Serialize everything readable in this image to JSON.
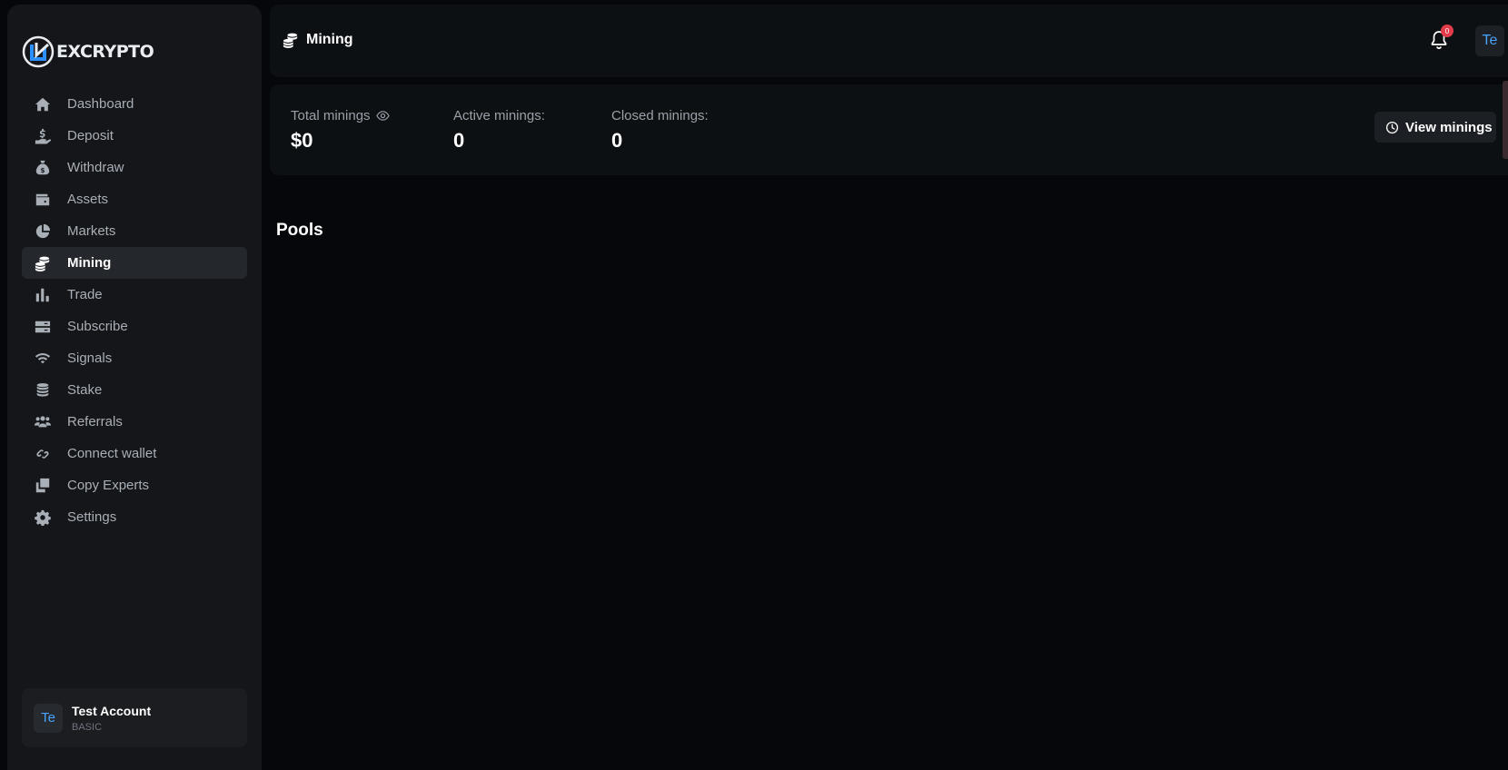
{
  "brand": {
    "name": "EXCRYPTO"
  },
  "sidebar": {
    "items": [
      {
        "label": "Dashboard",
        "icon": "home-icon",
        "active": false
      },
      {
        "label": "Deposit",
        "icon": "deposit-hand-icon",
        "active": false
      },
      {
        "label": "Withdraw",
        "icon": "money-bag-icon",
        "active": false
      },
      {
        "label": "Assets",
        "icon": "wallet-icon",
        "active": false
      },
      {
        "label": "Markets",
        "icon": "pie-chart-icon",
        "active": false
      },
      {
        "label": "Mining",
        "icon": "coins-icon",
        "active": true
      },
      {
        "label": "Trade",
        "icon": "bar-chart-icon",
        "active": false
      },
      {
        "label": "Subscribe",
        "icon": "server-icon",
        "active": false
      },
      {
        "label": "Signals",
        "icon": "wifi-icon",
        "active": false
      },
      {
        "label": "Stake",
        "icon": "coin-stack-icon",
        "active": false
      },
      {
        "label": "Referrals",
        "icon": "users-icon",
        "active": false
      },
      {
        "label": "Connect wallet",
        "icon": "link-icon",
        "active": false
      },
      {
        "label": "Copy Experts",
        "icon": "copy-icon",
        "active": false
      },
      {
        "label": "Settings",
        "icon": "gear-icon",
        "active": false
      }
    ],
    "account": {
      "initials": "Te",
      "name": "Test Account",
      "plan": "BASIC"
    }
  },
  "header": {
    "title": "Mining",
    "notifications_count": "0",
    "avatar_initials": "Te"
  },
  "stats": {
    "total_label": "Total minings",
    "total_value": "$0",
    "active_label": "Active minings:",
    "active_value": "0",
    "closed_label": "Closed minings:",
    "closed_value": "0",
    "view_button": "View minings"
  },
  "pools": {
    "title": "Pools"
  },
  "colors": {
    "background": "#05070a",
    "sidebar": "#141619",
    "card": "#0d1013",
    "accent_blue": "#4aa3ff",
    "badge_red": "#e23b4a"
  }
}
